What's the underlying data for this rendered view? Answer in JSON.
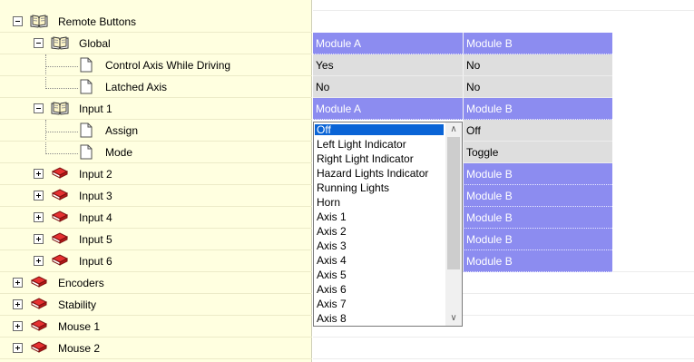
{
  "tree": {
    "items": [
      {
        "label": "Remote Buttons",
        "icon": "open-book-icon",
        "expander": "expanded"
      },
      {
        "label": "Global",
        "icon": "open-book-icon",
        "expander": "expanded"
      },
      {
        "label": "Control Axis While Driving",
        "icon": "page-icon"
      },
      {
        "label": "Latched Axis",
        "icon": "page-icon"
      },
      {
        "label": "Input 1",
        "icon": "open-book-icon",
        "expander": "expanded"
      },
      {
        "label": "Assign",
        "icon": "page-icon"
      },
      {
        "label": "Mode",
        "icon": "page-icon"
      },
      {
        "label": "Input 2",
        "icon": "closed-book-icon",
        "expander": "collapsed"
      },
      {
        "label": "Input 3",
        "icon": "closed-book-icon",
        "expander": "collapsed"
      },
      {
        "label": "Input 4",
        "icon": "closed-book-icon",
        "expander": "collapsed"
      },
      {
        "label": "Input 5",
        "icon": "closed-book-icon",
        "expander": "collapsed"
      },
      {
        "label": "Input 6",
        "icon": "closed-book-icon",
        "expander": "collapsed"
      },
      {
        "label": "Encoders",
        "icon": "closed-book-icon",
        "expander": "collapsed"
      },
      {
        "label": "Stability",
        "icon": "closed-book-icon",
        "expander": "collapsed"
      },
      {
        "label": "Mouse 1",
        "icon": "closed-book-icon",
        "expander": "collapsed"
      },
      {
        "label": "Mouse 2",
        "icon": "closed-book-icon",
        "expander": "collapsed"
      }
    ]
  },
  "grid": {
    "global": {
      "a": "Module A",
      "b": "Module B"
    },
    "control_axis": {
      "a": "Yes",
      "b": "No"
    },
    "latched_axis": {
      "a": "No",
      "b": "No"
    },
    "input1": {
      "a": "Module A",
      "b": "Module B"
    },
    "assign": {
      "b": "Off"
    },
    "mode": {
      "b": "Toggle"
    },
    "input2": {
      "b": "Module B"
    },
    "input3": {
      "b": "Module B"
    },
    "input4": {
      "b": "Module B"
    },
    "input5": {
      "b": "Module B"
    },
    "input6": {
      "b": "Module B"
    }
  },
  "dropdown": {
    "selected": "Off",
    "options": [
      "Off",
      "Left Light Indicator",
      "Right Light Indicator",
      "Hazard Lights Indicator",
      "Running Lights",
      "Horn",
      "Axis 1",
      "Axis 2",
      "Axis 3",
      "Axis 4",
      "Axis 5",
      "Axis 6",
      "Axis 7",
      "Axis 8"
    ],
    "scroll_up": "∧",
    "scroll_down": "∨"
  },
  "colors": {
    "tree_background": "#ffffe0",
    "module_cell": "#8c8cf0",
    "value_cell": "#dedede",
    "selection": "#0a64d6",
    "book_red": "#d32020"
  }
}
